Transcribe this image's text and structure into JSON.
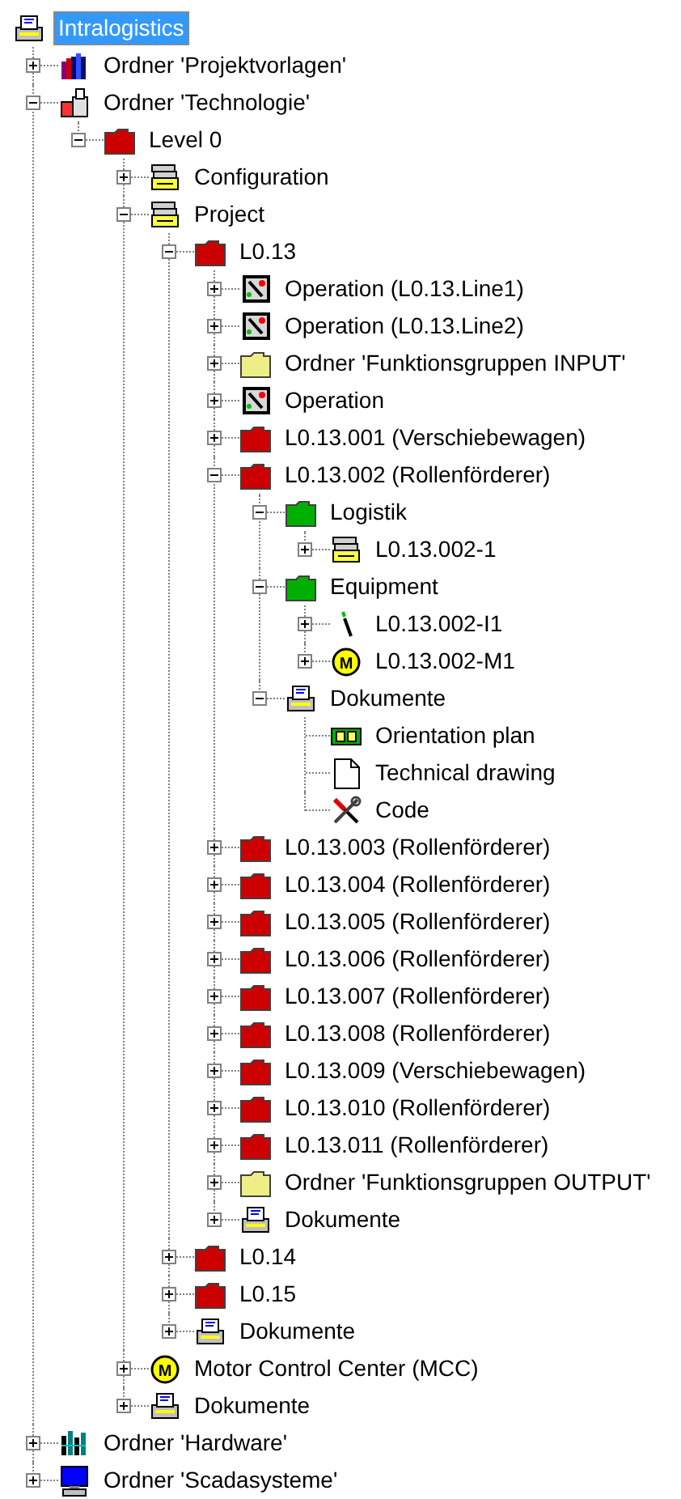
{
  "tree": {
    "label": "Intralogistics",
    "kind": "station",
    "selected": true,
    "children": [
      {
        "label": "Ordner 'Projektvorlagen'",
        "kind": "books",
        "expanded": false,
        "selected": false
      },
      {
        "label": "Ordner 'Technologie'",
        "kind": "factory",
        "expanded": true,
        "selected": false,
        "children": [
          {
            "label": "Level 0",
            "kind": "folder",
            "color": "#cc0000",
            "expanded": true,
            "selected": false,
            "children": [
              {
                "label": "Configuration",
                "kind": "archive",
                "expanded": false,
                "selected": false
              },
              {
                "label": "Project",
                "kind": "archive",
                "expanded": true,
                "selected": false,
                "children": [
                  {
                    "label": "L0.13",
                    "kind": "folder",
                    "color": "#cc0000",
                    "expanded": true,
                    "selected": false,
                    "children": [
                      {
                        "label": "Operation (L0.13.Line1)",
                        "kind": "operation",
                        "expanded": false,
                        "selected": false
                      },
                      {
                        "label": "Operation (L0.13.Line2)",
                        "kind": "operation",
                        "expanded": false,
                        "selected": false
                      },
                      {
                        "label": "Ordner 'Funktionsgruppen INPUT'",
                        "kind": "folder",
                        "color": "#eeee88",
                        "expanded": false,
                        "selected": false
                      },
                      {
                        "label": "Operation",
                        "kind": "operation",
                        "expanded": false,
                        "selected": false
                      },
                      {
                        "label": "L0.13.001 (Verschiebewagen)",
                        "kind": "folder",
                        "color": "#cc0000",
                        "expanded": false,
                        "selected": false
                      },
                      {
                        "label": "L0.13.002 (Rollenförderer)",
                        "kind": "folder",
                        "color": "#cc0000",
                        "expanded": true,
                        "selected": false,
                        "children": [
                          {
                            "label": "Logistik",
                            "kind": "folder",
                            "color": "#00b000",
                            "expanded": true,
                            "selected": false,
                            "children": [
                              {
                                "label": "L0.13.002-1",
                                "kind": "archive",
                                "expanded": false,
                                "selected": false
                              }
                            ]
                          },
                          {
                            "label": "Equipment",
                            "kind": "folder",
                            "color": "#00b000",
                            "expanded": true,
                            "selected": false,
                            "children": [
                              {
                                "label": "L0.13.002-I1",
                                "kind": "switch",
                                "expanded": false,
                                "selected": false
                              },
                              {
                                "label": "L0.13.002-M1",
                                "kind": "motor",
                                "badge": "M",
                                "expanded": false,
                                "selected": false
                              }
                            ]
                          },
                          {
                            "label": "Dokumente",
                            "kind": "station",
                            "expanded": true,
                            "selected": false,
                            "children": [
                              {
                                "label": "Orientation plan",
                                "kind": "plan",
                                "selected": false
                              },
                              {
                                "label": "Technical drawing",
                                "kind": "page",
                                "selected": false
                              },
                              {
                                "label": "Code",
                                "kind": "tools",
                                "selected": false
                              }
                            ]
                          }
                        ]
                      },
                      {
                        "label": "L0.13.003 (Rollenförderer)",
                        "kind": "folder",
                        "color": "#cc0000",
                        "expanded": false,
                        "selected": false
                      },
                      {
                        "label": "L0.13.004 (Rollenförderer)",
                        "kind": "folder",
                        "color": "#cc0000",
                        "expanded": false,
                        "selected": false
                      },
                      {
                        "label": "L0.13.005 (Rollenförderer)",
                        "kind": "folder",
                        "color": "#cc0000",
                        "expanded": false,
                        "selected": false
                      },
                      {
                        "label": "L0.13.006 (Rollenförderer)",
                        "kind": "folder",
                        "color": "#cc0000",
                        "expanded": false,
                        "selected": false
                      },
                      {
                        "label": "L0.13.007 (Rollenförderer)",
                        "kind": "folder",
                        "color": "#cc0000",
                        "expanded": false,
                        "selected": false
                      },
                      {
                        "label": "L0.13.008 (Rollenförderer)",
                        "kind": "folder",
                        "color": "#cc0000",
                        "expanded": false,
                        "selected": false
                      },
                      {
                        "label": "L0.13.009 (Verschiebewagen)",
                        "kind": "folder",
                        "color": "#cc0000",
                        "expanded": false,
                        "selected": false
                      },
                      {
                        "label": "L0.13.010 (Rollenförderer)",
                        "kind": "folder",
                        "color": "#cc0000",
                        "expanded": false,
                        "selected": false
                      },
                      {
                        "label": "L0.13.011 (Rollenförderer)",
                        "kind": "folder",
                        "color": "#cc0000",
                        "expanded": false,
                        "selected": false
                      },
                      {
                        "label": "Ordner 'Funktionsgruppen OUTPUT'",
                        "kind": "folder",
                        "color": "#eeee88",
                        "expanded": false,
                        "selected": false
                      },
                      {
                        "label": "Dokumente",
                        "kind": "station",
                        "expanded": false,
                        "selected": false
                      }
                    ]
                  },
                  {
                    "label": "L0.14",
                    "kind": "folder",
                    "color": "#cc0000",
                    "expanded": false,
                    "selected": false
                  },
                  {
                    "label": "L0.15",
                    "kind": "folder",
                    "color": "#cc0000",
                    "expanded": false,
                    "selected": false
                  },
                  {
                    "label": "Dokumente",
                    "kind": "station",
                    "expanded": false,
                    "selected": false
                  }
                ]
              },
              {
                "label": "Motor Control Center (MCC)",
                "kind": "motor",
                "badge": "M",
                "expanded": false,
                "selected": false
              },
              {
                "label": "Dokumente",
                "kind": "station",
                "expanded": false,
                "selected": false
              }
            ]
          }
        ]
      },
      {
        "label": "Ordner 'Hardware'",
        "kind": "hardware",
        "expanded": false,
        "selected": false
      },
      {
        "label": "Ordner 'Scadasysteme'",
        "kind": "computer",
        "expanded": false,
        "selected": false
      }
    ]
  }
}
